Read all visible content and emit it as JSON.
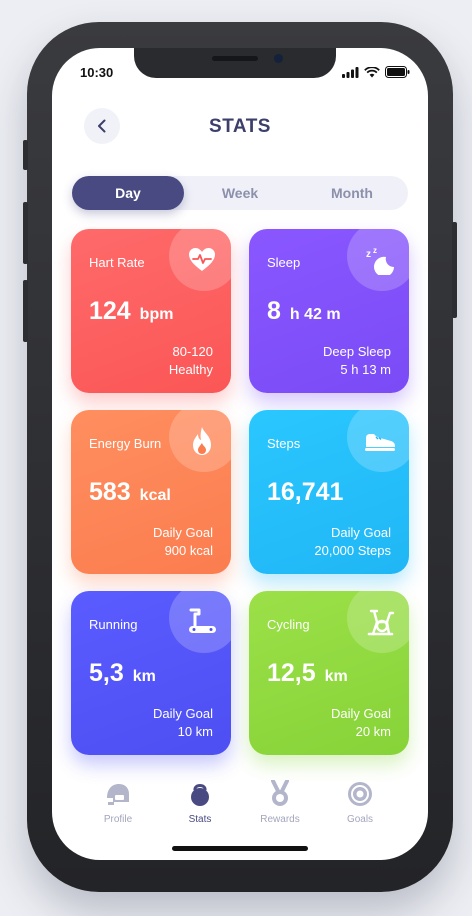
{
  "status_bar": {
    "time": "10:30"
  },
  "header": {
    "title": "STATS"
  },
  "segments": [
    {
      "label": "Day",
      "active": true
    },
    {
      "label": "Week",
      "active": false
    },
    {
      "label": "Month",
      "active": false
    }
  ],
  "cards": {
    "heart": {
      "label": "Hart Rate",
      "value": "124",
      "unit": "bpm",
      "foot1": "80-120",
      "foot2": "Healthy",
      "icon": "heart-pulse-icon",
      "color": "#fb5656"
    },
    "sleep": {
      "label": "Sleep",
      "value": "8",
      "unit": "h 42 m",
      "foot1": "Deep Sleep",
      "foot2": "5 h 13 m",
      "icon": "moon-zzz-icon",
      "color": "#7a4bf6"
    },
    "energy": {
      "label": "Energy Burn",
      "value": "583",
      "unit": "kcal",
      "foot1": "Daily Goal",
      "foot2": "900 kcal",
      "icon": "flame-icon",
      "color": "#fb7d4f"
    },
    "steps": {
      "label": "Steps",
      "value": "16,741",
      "unit": "",
      "foot1": "Daily Goal",
      "foot2": "20,000 Steps",
      "icon": "sneaker-icon",
      "color": "#20b6f5"
    },
    "running": {
      "label": "Running",
      "value": "5,3",
      "unit": "km",
      "foot1": "Daily Goal",
      "foot2": "10 km",
      "icon": "treadmill-icon",
      "color": "#4d4ff2"
    },
    "cycling": {
      "label": "Cycling",
      "value": "12,5",
      "unit": "km",
      "foot1": "Daily Goal",
      "foot2": "20 km",
      "icon": "exercise-bike-icon",
      "color": "#86d338"
    }
  },
  "tabbar": [
    {
      "label": "Profile",
      "icon": "helmet-icon",
      "active": false
    },
    {
      "label": "Stats",
      "icon": "kettlebell-icon",
      "active": true
    },
    {
      "label": "Rewards",
      "icon": "medal-icon",
      "active": false
    },
    {
      "label": "Goals",
      "icon": "target-icon",
      "active": false
    }
  ]
}
